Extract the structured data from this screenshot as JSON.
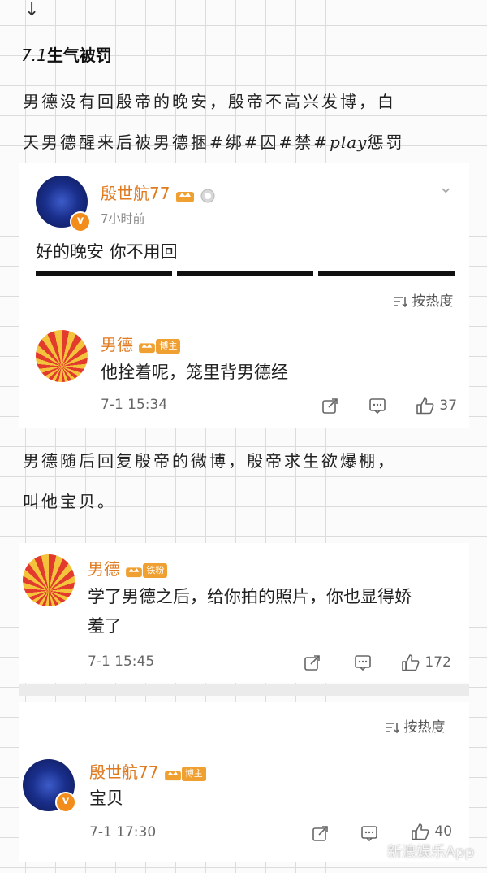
{
  "top_arrow": "↓",
  "section": {
    "number": "7.1",
    "title": "生气被罚"
  },
  "notes": [
    {
      "lines": [
        "男德没有回殷帝的晚安，殷帝不高兴发博，白",
        "天男德醒来后被男德捆#绑#囚#禁#"
      ],
      "play": "play",
      "suffix": "惩罚"
    },
    {
      "lines": [
        "男德随后回复殷帝的微博，殷帝求生欲爆棚，",
        "叫他宝贝。"
      ]
    }
  ],
  "post": {
    "author": "殷世航77",
    "time": "7小时前",
    "text": "好的晚安 你不用回",
    "sort_label": "按热度"
  },
  "comments": [
    {
      "author": "男德",
      "tag": "博主",
      "text": "他拴着呢，笼里背男德经",
      "time": "7-1 15:34",
      "likes": "37"
    },
    {
      "author": "男德",
      "tag": "铁粉",
      "text_lines": [
        "学了男德之后，给你拍的照片，你也显得娇",
        "羞了"
      ],
      "time": "7-1 15:45",
      "likes": "172"
    },
    {
      "author": "殷世航77",
      "tag": "博主",
      "text": "宝贝",
      "time": "7-1 17:30",
      "likes": "40"
    }
  ],
  "sort_label_2": "按热度",
  "watermark": "新浪娱乐App",
  "colors": {
    "username": "#e07a1f",
    "badge": "#f28c1b",
    "tag": "#f0a030"
  },
  "icons": [
    "chevron-down-icon",
    "crown-vip-icon",
    "medal-icon",
    "verified-icon",
    "sort-icon",
    "share-icon",
    "comment-icon",
    "like-icon"
  ]
}
